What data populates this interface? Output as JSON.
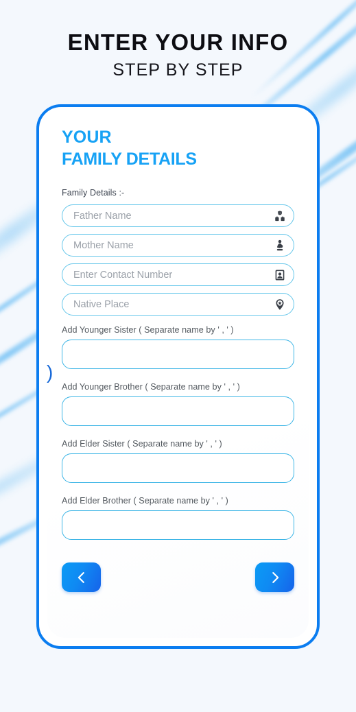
{
  "header": {
    "title_main": "ENTER YOUR INFO",
    "title_sub": "STEP BY STEP"
  },
  "card": {
    "heading_line1": "YOUR",
    "heading_line2": "FAMILY DETAILS",
    "section_label": "Family Details :-"
  },
  "fields": [
    {
      "name": "father-name",
      "placeholder": "Father Name",
      "value": "",
      "icon": "elderly-man-icon"
    },
    {
      "name": "mother-name",
      "placeholder": "Mother Name",
      "value": "",
      "icon": "pregnant-woman-icon"
    },
    {
      "name": "contact-number",
      "placeholder": "Enter Contact Number",
      "value": "",
      "icon": "contact-card-icon"
    },
    {
      "name": "native-place",
      "placeholder": "Native Place",
      "value": "",
      "icon": "map-pin-star-icon"
    }
  ],
  "textareas": [
    {
      "name": "younger-sister",
      "label": "Add Younger Sister ( Separate name by ' , ' )",
      "value": ""
    },
    {
      "name": "younger-brother",
      "label": "Add Younger Brother ( Separate name by ' , ' )",
      "value": ""
    },
    {
      "name": "elder-sister",
      "label": "Add Elder Sister ( Separate name by ' , ' )",
      "value": ""
    },
    {
      "name": "elder-brother",
      "label": "Add Elder Brother ( Separate name by ' , ' )",
      "value": ""
    }
  ],
  "nav": {
    "prev_icon": "chevron-left-icon",
    "next_icon": "chevron-right-icon"
  },
  "artifact": {
    "paren": ")"
  },
  "colors": {
    "accent_blue": "#17a2f5",
    "frame_blue": "#0b7df0",
    "input_border": "#64c6ea",
    "textarea_border": "#3cb5e6",
    "placeholder": "#9aa0a8",
    "background": "#f4f8fd",
    "streak_blue": "#78c3f5"
  }
}
